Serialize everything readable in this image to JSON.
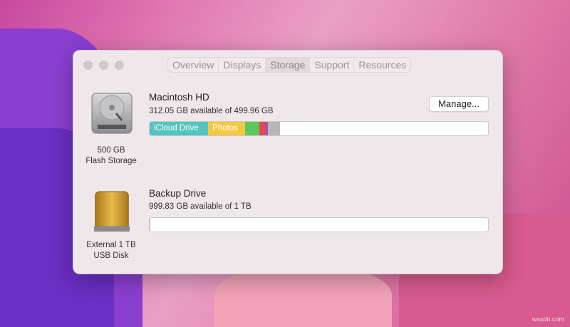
{
  "tabs": [
    "Overview",
    "Displays",
    "Storage",
    "Support",
    "Resources"
  ],
  "active_tab": "Storage",
  "disks": [
    {
      "name": "Macintosh HD",
      "available": "312.05 GB available of 499.96 GB",
      "caption_line1": "500 GB",
      "caption_line2": "Flash Storage",
      "button": "Manage...",
      "segments": [
        {
          "label": "iCloud Drive",
          "color": "#54c4bf",
          "percent": 17.3
        },
        {
          "label": "Photos",
          "color": "#f5c842",
          "percent": 10.9
        },
        {
          "label": "",
          "color": "#5ac85a",
          "percent": 4.2
        },
        {
          "label": "",
          "color": "#e3455a",
          "percent": 1.9
        },
        {
          "label": "",
          "color": "#9a5bb0",
          "percent": 0.6
        },
        {
          "label": "",
          "color": "#b9b6b8",
          "percent": 3.6
        }
      ]
    },
    {
      "name": "Backup Drive",
      "available": "999.83 GB available of 1 TB",
      "caption_line1": "External 1 TB",
      "caption_line2": "USB Disk",
      "segments": [
        {
          "label": "",
          "color": "#b9b6b8",
          "percent": 0.3
        }
      ]
    }
  ],
  "watermark": "wsxdn.com"
}
